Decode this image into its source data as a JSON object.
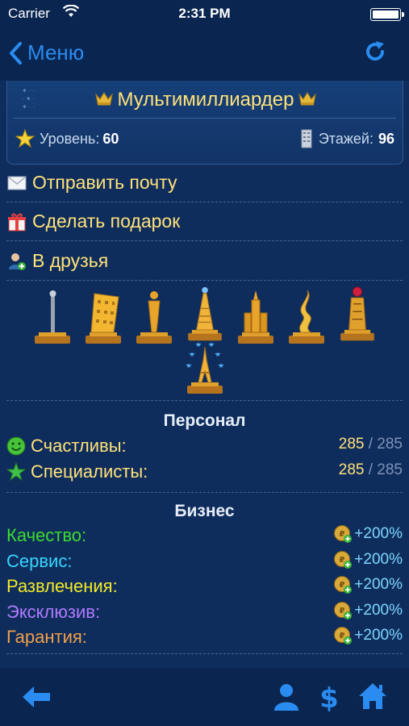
{
  "status_bar": {
    "carrier": "Carrier",
    "time": "2:31 PM"
  },
  "nav": {
    "back_label": "Меню",
    "icons": [
      "chevron-left-icon",
      "refresh-icon"
    ],
    "accent_color": "#2a8cf0"
  },
  "profile": {
    "rank": "Мультимиллиардер",
    "level_label": "Уровень:",
    "level_value": "60",
    "floors_label": "Этажей:",
    "floors_value": "96"
  },
  "actions": [
    {
      "label": "Отправить почту",
      "icon": "mail-icon"
    },
    {
      "label": "Сделать подарок",
      "icon": "gift-icon"
    },
    {
      "label": "В друзья",
      "icon": "add-friend-icon"
    }
  ],
  "trophies": [
    "needle-trophy-icon",
    "building-trophy-icon",
    "statue-trophy-icon",
    "tower-trophy-icon",
    "kremlin-trophy-icon",
    "twisted-tower-trophy-icon",
    "red-gem-trophy-icon",
    "eiffel-tower-trophy-icon"
  ],
  "personnel": {
    "title": "Персонал",
    "rows": [
      {
        "label": "Счастливы:",
        "value": "285",
        "sep": " / ",
        "max": "285",
        "icon": "smiley-icon"
      },
      {
        "label": "Специалисты:",
        "value": "285",
        "sep": " / ",
        "max": "285",
        "icon": "star-icon"
      }
    ]
  },
  "business": {
    "title": "Бизнес",
    "rows": [
      {
        "label": "Качество:",
        "value": "+200%",
        "color": "#3ddc2f"
      },
      {
        "label": "Сервис:",
        "value": "+200%",
        "color": "#36d6ff"
      },
      {
        "label": "Развлечения:",
        "value": "+200%",
        "color": "#f2ea2a"
      },
      {
        "label": "Эксклюзив:",
        "value": "+200%",
        "color": "#b07aff"
      },
      {
        "label": "Гарантия:",
        "value": "+200%",
        "color": "#f0a04a"
      }
    ]
  },
  "toolbar": {
    "icons": [
      "back-arrow-icon",
      "person-icon",
      "dollar-icon",
      "home-icon"
    ]
  }
}
